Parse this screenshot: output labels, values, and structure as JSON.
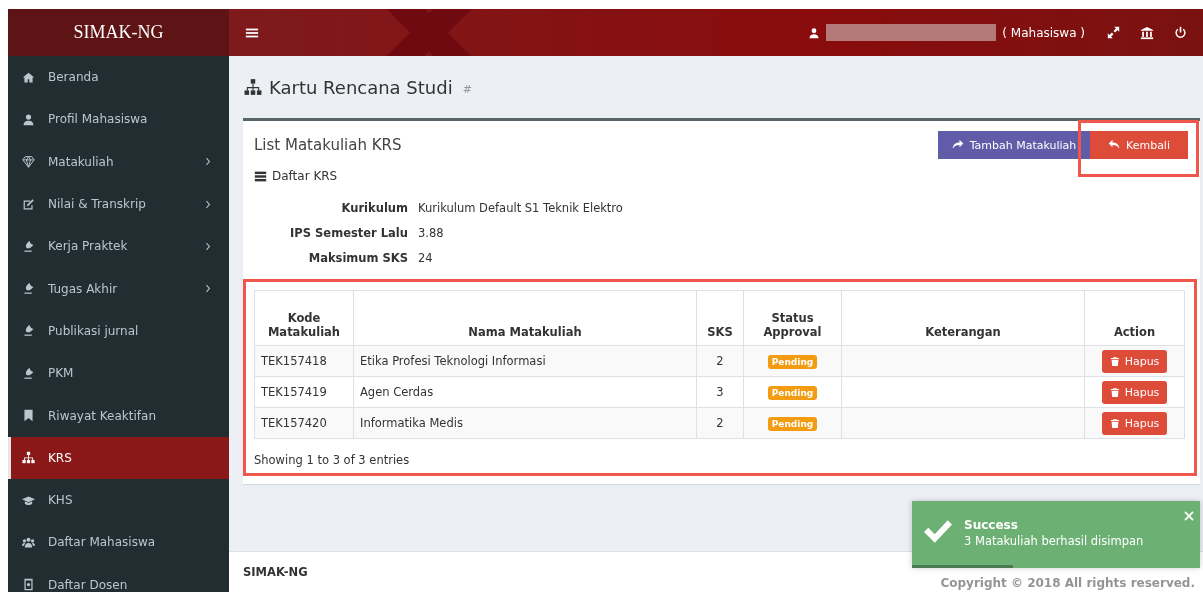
{
  "header": {
    "brand": "SIMAK-NG",
    "user_role": "( Mahasiswa )"
  },
  "sidebar": {
    "items": [
      {
        "label": "Beranda",
        "has_submenu": false,
        "selected": false
      },
      {
        "label": "Profil Mahasiswa",
        "has_submenu": false,
        "selected": false
      },
      {
        "label": "Matakuliah",
        "has_submenu": true,
        "selected": false
      },
      {
        "label": "Nilai & Transkrip",
        "has_submenu": true,
        "selected": false
      },
      {
        "label": "Kerja Praktek",
        "has_submenu": true,
        "selected": false
      },
      {
        "label": "Tugas Akhir",
        "has_submenu": true,
        "selected": false
      },
      {
        "label": "Publikasi jurnal",
        "has_submenu": false,
        "selected": false
      },
      {
        "label": "PKM",
        "has_submenu": false,
        "selected": false
      },
      {
        "label": "Riwayat Keaktifan",
        "has_submenu": false,
        "selected": false
      },
      {
        "label": "KRS",
        "has_submenu": false,
        "selected": true
      },
      {
        "label": "KHS",
        "has_submenu": false,
        "selected": false
      },
      {
        "label": "Daftar Mahasiswa",
        "has_submenu": false,
        "selected": false
      },
      {
        "label": "Daftar Dosen",
        "has_submenu": false,
        "selected": false
      }
    ]
  },
  "page": {
    "title": "Kartu Rencana Studi",
    "title_suffix": "#"
  },
  "box": {
    "title": "List Matakuliah KRS",
    "buttons": [
      {
        "label": "Tambah Matakuliah",
        "kind": "add",
        "highlighted": false
      },
      {
        "label": "Kembali",
        "kind": "back",
        "highlighted": true
      }
    ],
    "subtitle": "Daftar KRS",
    "info": [
      {
        "label": "Kurikulum",
        "value": "Kurikulum Default S1 Teknik Elektro"
      },
      {
        "label": "IPS Semester Lalu",
        "value": "3.88"
      },
      {
        "label": "Maksimum SKS",
        "value": "24"
      }
    ],
    "table": {
      "highlighted": true,
      "columns": [
        "Kode Matakuliah",
        "Nama Matakuliah",
        "SKS",
        "Status Approval",
        "Keterangan",
        "Action"
      ],
      "rows": [
        {
          "kode": "TEK157418",
          "nama": "Etika Profesi Teknologi Informasi",
          "sks": "2",
          "status": "Pending",
          "action": "Hapus"
        },
        {
          "kode": "TEK157419",
          "nama": "Agen Cerdas",
          "sks": "3",
          "status": "Pending",
          "action": "Hapus"
        },
        {
          "kode": "TEK157420",
          "nama": "Informatika Medis",
          "sks": "2",
          "status": "Pending",
          "action": "Hapus"
        }
      ],
      "info": "Showing 1 to 3 of 3 entries"
    }
  },
  "footer": {
    "brand": "SIMAK-NG",
    "copyright": "Copyright © 2018 All rights reserved."
  },
  "toast": {
    "kind": "success",
    "level": 0.35,
    "title": "Success",
    "message": "3 Matakuliah berhasil disimpan"
  }
}
